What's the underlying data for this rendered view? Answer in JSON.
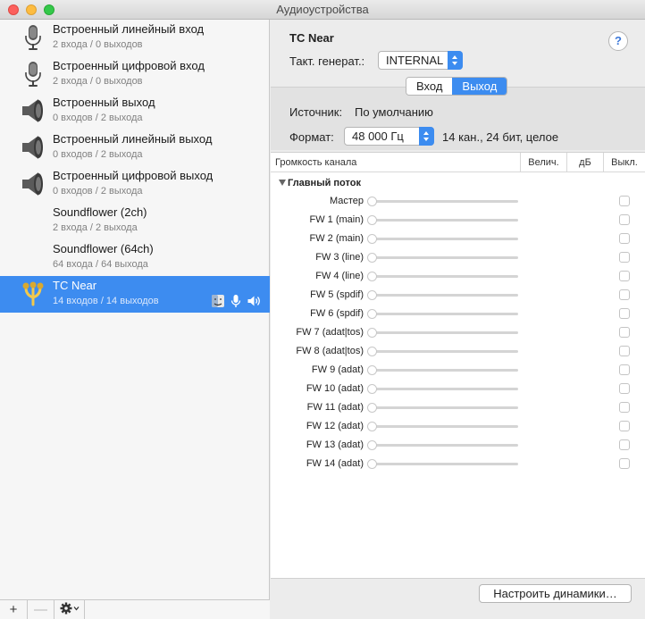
{
  "window": {
    "title": "Аудиоустройства"
  },
  "devices": [
    {
      "name": "Встроенный линейный вход",
      "io": "2 входа / 0 выходов",
      "icon": "microphone-icon",
      "selected": false
    },
    {
      "name": "Встроенный цифровой вход",
      "io": "2 входа / 0 выходов",
      "icon": "microphone-icon",
      "selected": false
    },
    {
      "name": "Встроенный выход",
      "io": "0 входов / 2 выхода",
      "icon": "speaker-icon",
      "selected": false
    },
    {
      "name": "Встроенный линейный выход",
      "io": "0 входов / 2 выхода",
      "icon": "speaker-icon",
      "selected": false
    },
    {
      "name": "Встроенный цифровой выход",
      "io": "0 входов / 2 выхода",
      "icon": "speaker-icon",
      "selected": false
    },
    {
      "name": "Soundflower (2ch)",
      "io": "2 входа / 2 выхода",
      "icon": "",
      "selected": false
    },
    {
      "name": "Soundflower (64ch)",
      "io": "64 входа / 64 выхода",
      "icon": "",
      "selected": false
    },
    {
      "name": "TC Near",
      "io": "14 входов / 14 выходов",
      "icon": "firewire-icon",
      "selected": true
    }
  ],
  "sidebar_footer": {
    "add": "+",
    "remove": "—"
  },
  "detail": {
    "device_title": "TC Near",
    "help": "?",
    "clock_label": "Такт. генерат.:",
    "clock_value": "INTERNAL",
    "tabs": [
      {
        "label": "Вход",
        "active": false
      },
      {
        "label": "Выход",
        "active": true
      }
    ],
    "source_label": "Источник:",
    "source_value": "По умолчанию",
    "format_label": "Формат:",
    "format_value": "48 000 Гц",
    "format_desc": "14 кан., 24 бит, целое"
  },
  "table": {
    "headers": {
      "volume": "Громкость канала",
      "value": "Велич.",
      "db": "дБ",
      "mute": "Выкл."
    },
    "group": "Главный поток",
    "channels": [
      "Мастер",
      "FW 1 (main)",
      "FW 2 (main)",
      "FW 3 (line)",
      "FW 4 (line)",
      "FW 5 (spdif)",
      "FW 6 (spdif)",
      "FW 7 (adat|tos)",
      "FW 8 (adat|tos)",
      "FW 9 (adat)",
      "FW 10 (adat)",
      "FW 11 (adat)",
      "FW 12 (adat)",
      "FW 13 (adat)",
      "FW 14 (adat)"
    ]
  },
  "configure_speakers": "Настроить динамики…",
  "colors": {
    "selection": "#3d8cf0",
    "accent": "#3c8cf0"
  }
}
